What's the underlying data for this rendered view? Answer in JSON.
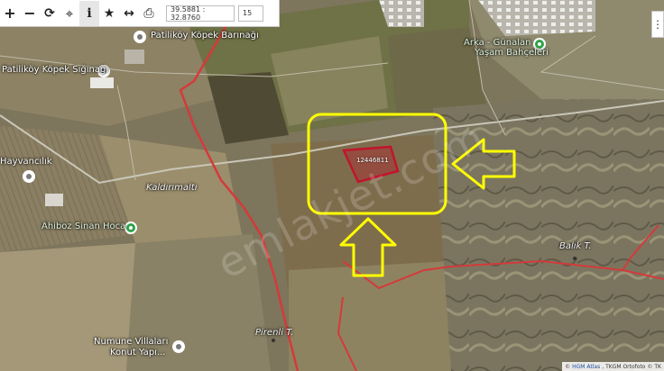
{
  "toolbar": {
    "tools": [
      {
        "name": "zoom-in",
        "glyph": "+"
      },
      {
        "name": "zoom-out",
        "glyph": "−"
      },
      {
        "name": "refresh",
        "glyph": "⟳"
      },
      {
        "name": "locate",
        "glyph": "⌖"
      },
      {
        "name": "info",
        "glyph": "i"
      },
      {
        "name": "favorite",
        "glyph": "★"
      },
      {
        "name": "measure",
        "glyph": "↔"
      },
      {
        "name": "print",
        "glyph": "⎙"
      }
    ],
    "coordinates": "39.5881 : 32.8760",
    "zoom_level": "15"
  },
  "map": {
    "places": [
      {
        "label": "Patiliköy Köpek Barınağı",
        "icon": "place-pin"
      },
      {
        "label": "Patiliköy Köpek Sığınağı",
        "icon": "place-pin"
      },
      {
        "label": "Hayvancılık",
        "icon": "place-pin"
      },
      {
        "label": "Ahiboz Sinan Hoca",
        "icon": "green-flower-pin"
      },
      {
        "label": "Arka - Günalan Yaşam Bahçeleri",
        "icon": "green-flower-pin"
      },
      {
        "label": "Numune Villaları Konut Yapı...",
        "icon": "place-pin"
      }
    ],
    "place_arka_line1": "Arka - Günalan",
    "place_arka_line2": "Yaşam Bahçeleri",
    "place_numune_line1": "Numune Villaları",
    "place_numune_line2": "Konut Yapı...",
    "locality_labels": [
      "Kaldırımaltı",
      "Balık T.",
      "Pirenli T."
    ],
    "parcel_label": "12446811",
    "watermark": "emlakjet.com",
    "attribution": {
      "prefix": "©",
      "link1": "HGM Atlas",
      "sep": ",",
      "text2": "TKGM Ortofoto",
      "text3": "© TK"
    },
    "colors": {
      "highlight": "#ffff00",
      "boundary": "#d43a3a",
      "parcel": "#c0152b"
    }
  }
}
